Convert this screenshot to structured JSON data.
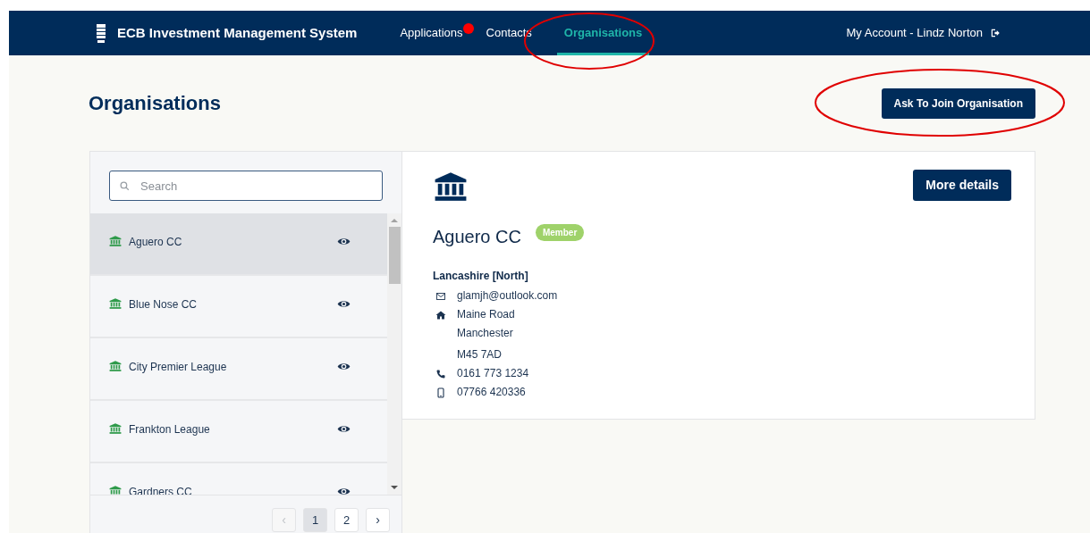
{
  "navbar": {
    "title": "ECB Investment Management System",
    "links": [
      {
        "label": "Applications",
        "selected": false,
        "notification": true
      },
      {
        "label": "Contacts",
        "selected": false,
        "notification": false
      },
      {
        "label": "Organisations",
        "selected": true,
        "notification": false
      }
    ],
    "account": "My Account - Lindz Norton"
  },
  "page": {
    "title": "Organisations",
    "action": "Ask To Join Organisation"
  },
  "list": {
    "search": {
      "placeholder": "Search"
    },
    "items": [
      {
        "name": "Aguero CC",
        "selected": true
      },
      {
        "name": "Blue Nose CC",
        "selected": false
      },
      {
        "name": "City Premier League",
        "selected": false
      },
      {
        "name": "Frankton League",
        "selected": false
      },
      {
        "name": "Gardners CC",
        "selected": false
      }
    ],
    "pagination": {
      "prev": "‹",
      "pages": [
        {
          "label": "1",
          "selected": true
        },
        {
          "label": "2",
          "selected": false
        }
      ],
      "next": "›"
    }
  },
  "detail": {
    "button": "More details",
    "name": "Aguero CC",
    "badge": "Member",
    "region": "Lancashire [North]",
    "contacts": [
      {
        "kind": "email",
        "lines": [
          "glamjh@outlook.com"
        ]
      },
      {
        "kind": "address",
        "lines": [
          "Maine Road",
          "Manchester",
          "M45 7AD"
        ]
      },
      {
        "kind": "phone",
        "lines": [
          "0161 773 1234"
        ]
      },
      {
        "kind": "mobile",
        "lines": [
          "07766 420336"
        ]
      }
    ]
  }
}
